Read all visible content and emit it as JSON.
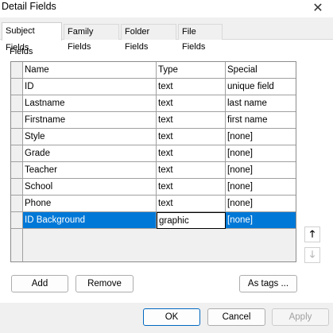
{
  "window": {
    "title": "Detail Fields",
    "close_glyph": "✕"
  },
  "tabs": [
    {
      "label": "Subject Fields",
      "active": true
    },
    {
      "label": "Family Fields",
      "active": false
    },
    {
      "label": "Folder Fields",
      "active": false
    },
    {
      "label": "File Fields",
      "active": false
    }
  ],
  "fields_group": {
    "label": "Fields",
    "columns": [
      "Name",
      "Type",
      "Special"
    ],
    "rows": [
      {
        "name": "ID",
        "type": "text",
        "special": "unique field"
      },
      {
        "name": "Lastname",
        "type": "text",
        "special": "last name"
      },
      {
        "name": "Firstname",
        "type": "text",
        "special": "first name"
      },
      {
        "name": "Style",
        "type": "text",
        "special": "[none]"
      },
      {
        "name": "Grade",
        "type": "text",
        "special": "[none]"
      },
      {
        "name": "Teacher",
        "type": "text",
        "special": "[none]"
      },
      {
        "name": "School",
        "type": "text",
        "special": "[none]"
      },
      {
        "name": "Phone",
        "type": "text",
        "special": "[none]"
      },
      {
        "name": "ID Background",
        "type": "graphic",
        "special": "[none]",
        "selected": true
      }
    ]
  },
  "move_buttons": {
    "up": {
      "icon": "arrow-up-icon",
      "glyph": "🡑",
      "enabled": true
    },
    "down": {
      "icon": "arrow-down-icon",
      "glyph": "🡓",
      "enabled": false
    }
  },
  "actions": {
    "add": "Add",
    "remove": "Remove",
    "as_tags": "As tags ..."
  },
  "dialog_buttons": {
    "ok": "OK",
    "cancel": "Cancel",
    "apply": "Apply"
  },
  "colors": {
    "selection": "#0078d7",
    "default_button_border": "#0067c0"
  }
}
